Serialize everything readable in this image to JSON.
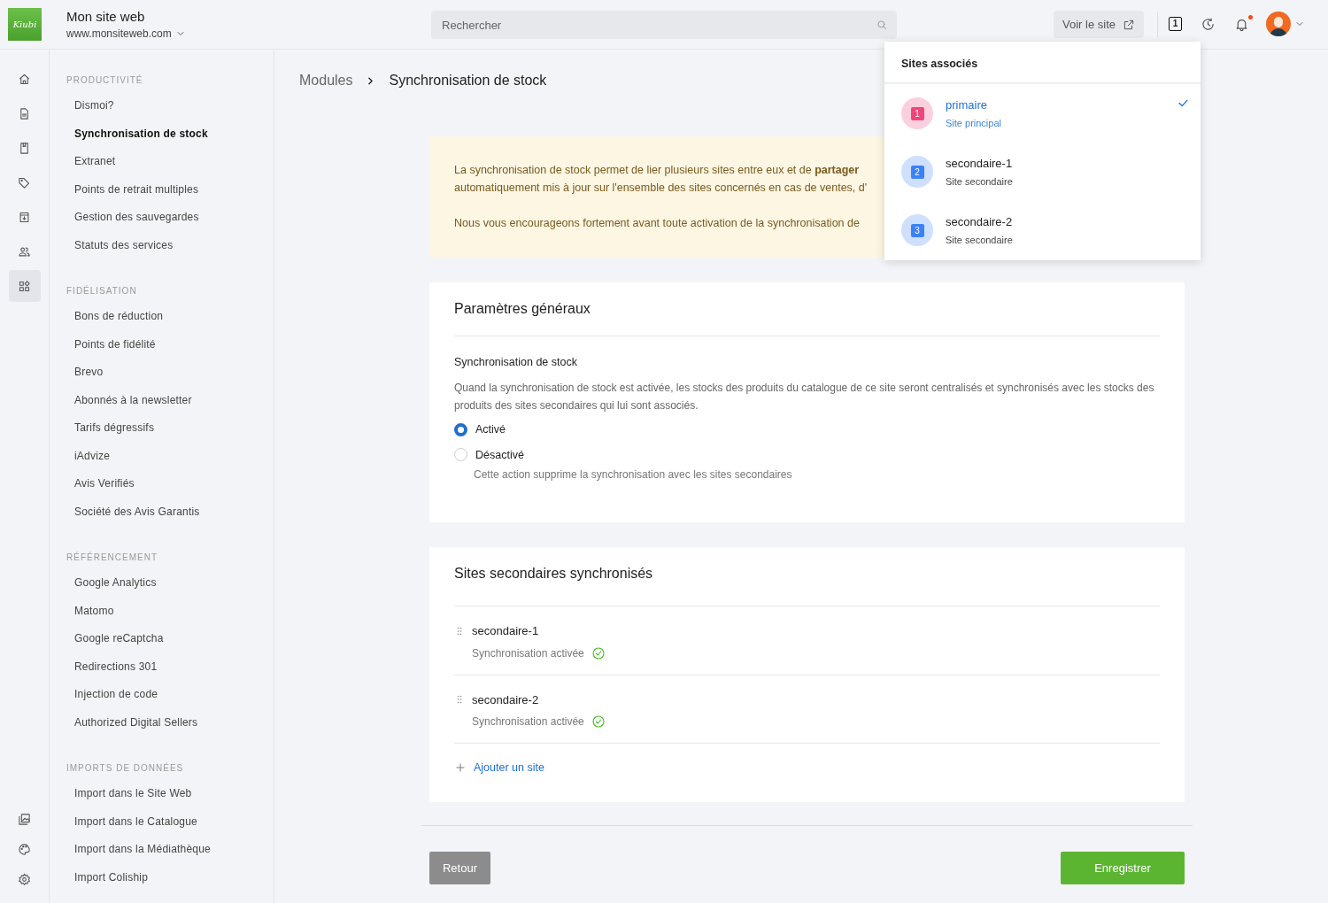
{
  "header": {
    "logo": "Kiubi",
    "site_title": "Mon site web",
    "site_url": "www.monsiteweb.com",
    "search": {
      "placeholder": "Rechercher"
    },
    "view_site": "Voir le site",
    "site_badge": "1",
    "notification_unread": true
  },
  "rail": [
    {
      "selected": false
    },
    {
      "selected": false
    },
    {
      "selected": false
    },
    {
      "selected": false
    },
    {
      "selected": false
    },
    {
      "selected": false
    },
    {
      "selected": true
    }
  ],
  "sidebar": [
    {
      "title": "PRODUCTIVITÉ",
      "items": [
        {
          "label": "Dismoi?",
          "selected": false
        },
        {
          "label": "Synchronisation de stock",
          "selected": true
        },
        {
          "label": "Extranet",
          "selected": false
        },
        {
          "label": "Points de retrait multiples",
          "selected": false
        },
        {
          "label": "Gestion des sauvegardes",
          "selected": false
        },
        {
          "label": "Statuts des services",
          "selected": false
        }
      ]
    },
    {
      "title": "FIDÉLISATION",
      "items": [
        {
          "label": "Bons de réduction",
          "selected": false
        },
        {
          "label": "Points de fidélité",
          "selected": false
        },
        {
          "label": "Brevo",
          "selected": false
        },
        {
          "label": "Abonnés à la newsletter",
          "selected": false
        },
        {
          "label": "Tarifs dégressifs",
          "selected": false
        },
        {
          "label": "iAdvize",
          "selected": false
        },
        {
          "label": "Avis Verifiés",
          "selected": false
        },
        {
          "label": "Société des Avis Garantis",
          "selected": false
        }
      ]
    },
    {
      "title": "RÉFÉRENCEMENT",
      "items": [
        {
          "label": "Google Analytics",
          "selected": false
        },
        {
          "label": "Matomo",
          "selected": false
        },
        {
          "label": "Google reCaptcha",
          "selected": false
        },
        {
          "label": "Redirections 301",
          "selected": false
        },
        {
          "label": "Injection de code",
          "selected": false
        },
        {
          "label": "Authorized Digital Sellers",
          "selected": false
        }
      ]
    },
    {
      "title": "IMPORTS DE DONNÉES",
      "items": [
        {
          "label": "Import dans le Site Web",
          "selected": false
        },
        {
          "label": "Import dans le Catalogue",
          "selected": false
        },
        {
          "label": "Import dans la Médiathèque",
          "selected": false
        },
        {
          "label": "Import Coliship",
          "selected": false
        }
      ]
    }
  ],
  "breadcrumb": [
    "Modules",
    "Synchronisation de stock"
  ],
  "notice": {
    "paragraphs": [
      [
        "La synchronisation de stock permet de lier plusieurs sites entre eux et de **partager**",
        "automatiquement mis à jour sur l'ensemble des sites concernés en cas de ventes, d'"
      ],
      [
        "Nous vous encourageons fortement avant toute activation de la synchronisation de"
      ]
    ]
  },
  "general": {
    "title": "Paramètres généraux",
    "field_label": "Synchronisation de stock",
    "description": "Quand la synchronisation de stock est activée, les stocks des produits du catalogue de ce site seront centralisés et synchronisés avec les stocks des produits des sites secondaires qui lui sont associés.",
    "options": [
      {
        "label": "Activé",
        "selected": true
      },
      {
        "label": "Désactivé",
        "selected": false,
        "help": "Cette action supprime la synchronisation avec les sites secondaires"
      }
    ]
  },
  "secondary": {
    "title": "Sites secondaires synchronisés",
    "sites": [
      {
        "name": "secondaire-1",
        "status": "Synchronisation activée"
      },
      {
        "name": "secondaire-2",
        "status": "Synchronisation activée"
      }
    ],
    "add_link": "Ajouter un site"
  },
  "buttons": {
    "back": "Retour",
    "save": "Enregistrer"
  },
  "dropdown": {
    "title": "Sites associés",
    "items": [
      {
        "number": "1",
        "name": "primaire",
        "role": "Site principal",
        "selected": true,
        "color": "#f0457a"
      },
      {
        "number": "2",
        "name": "secondaire-1",
        "role": "Site secondaire",
        "selected": false,
        "color": "#3b82f6"
      },
      {
        "number": "3",
        "name": "secondaire-2",
        "role": "Site secondaire",
        "selected": false,
        "color": "#3b82f6"
      }
    ]
  }
}
